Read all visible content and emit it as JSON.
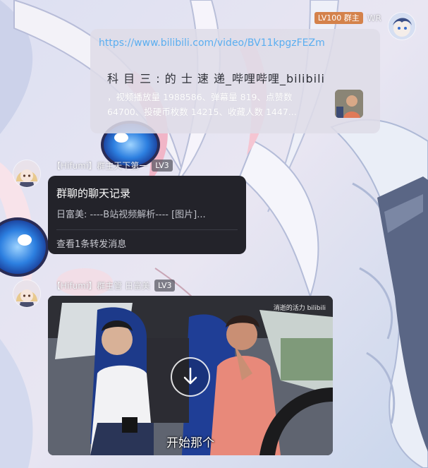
{
  "messages": [
    {
      "sender": {
        "badge": "LV100 群主",
        "name": "WR"
      },
      "link_card": {
        "url": "https://www.bilibili.com/video/BV11kpgzFEZm",
        "title": "科 目 三 : 的 士 速 递_哔哩哔哩_bilibili",
        "description": "，视频播放量 1988586、弹幕量 819、点赞数 64700、投硬币枚数 14215、收藏人数 1447..."
      }
    },
    {
      "sender": {
        "name": "【Hifumi】群主天下第一",
        "badge": "LV3"
      },
      "forward": {
        "title": "群聊的聊天记录",
        "preview": "日富美: ----B站视频解析---- [图片]...",
        "footer": "查看1条转发消息"
      }
    },
    {
      "sender": {
        "name": "【Hifumi】群主管 日富美",
        "badge": "LV3"
      },
      "video": {
        "subtitle": "开始那个",
        "watermark": "消逝的活力 bilibili"
      }
    }
  ],
  "colors": {
    "owner_badge": "#d4824b",
    "link": "#5aaef0",
    "forward_bg": "#23232a"
  }
}
